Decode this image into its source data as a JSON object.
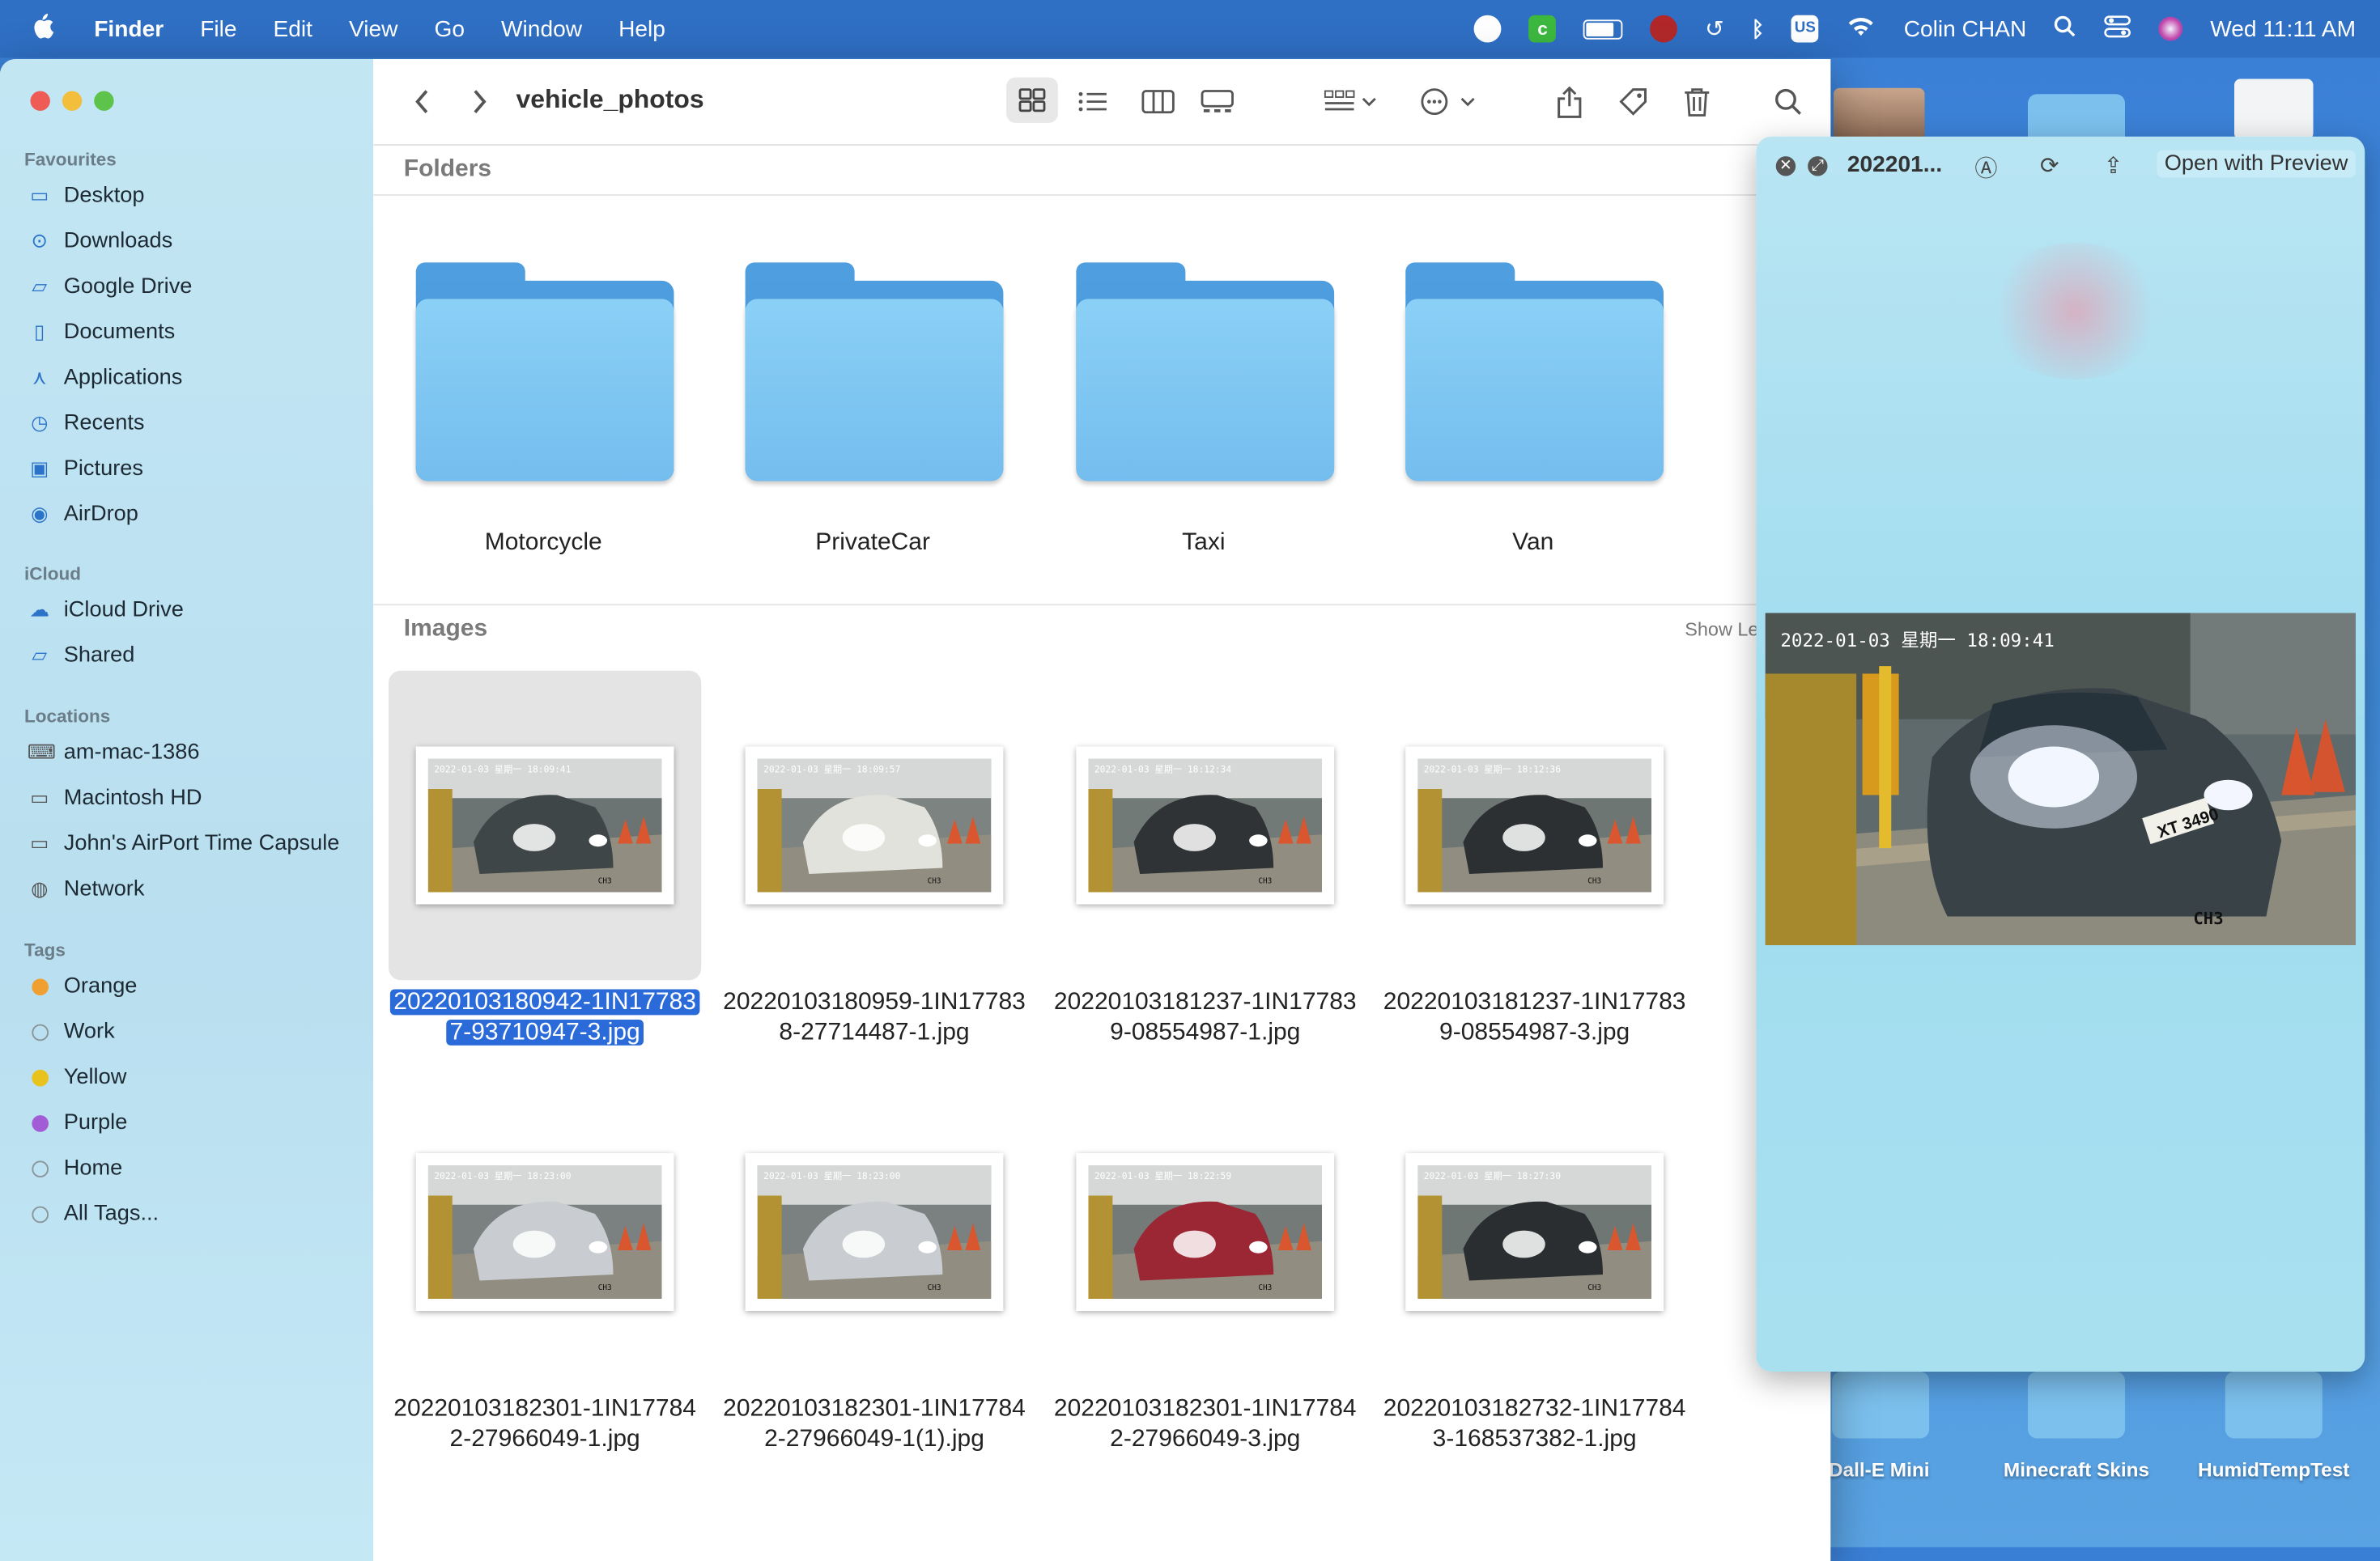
{
  "menubar": {
    "app": "Finder",
    "items": [
      "File",
      "Edit",
      "View",
      "Go",
      "Window",
      "Help"
    ],
    "user": "Colin CHAN",
    "clock": "Wed  11:11 AM",
    "input_source": "US"
  },
  "desktop": {
    "items": [
      "Dall-E Mini",
      "Minecraft Skins",
      "HumidTempTest"
    ]
  },
  "finder": {
    "title": "vehicle_photos",
    "sidebar": {
      "favourites_label": "Favourites",
      "favourites": [
        "Desktop",
        "Downloads",
        "Google Drive",
        "Documents",
        "Applications",
        "Recents",
        "Pictures",
        "AirDrop"
      ],
      "icloud_label": "iCloud",
      "icloud": [
        "iCloud Drive",
        "Shared"
      ],
      "locations_label": "Locations",
      "locations": [
        "am-mac-1386",
        "Macintosh HD",
        "John's AirPort Time Capsule",
        "Network"
      ],
      "tags_label": "Tags",
      "tags": [
        {
          "name": "Orange",
          "color": "#f0a030"
        },
        {
          "name": "Work",
          "color": ""
        },
        {
          "name": "Yellow",
          "color": "#e8c21d"
        },
        {
          "name": "Purple",
          "color": "#a25cd6"
        },
        {
          "name": "Home",
          "color": ""
        },
        {
          "name": "All Tags...",
          "color": ""
        }
      ]
    },
    "folders_label": "Folders",
    "folders": [
      "Motorcycle",
      "PrivateCar",
      "Taxi",
      "Van"
    ],
    "images_label": "Images",
    "show_less": "Show Le",
    "images": [
      {
        "line1": "20220103180942-1IN17783",
        "line2": "7-93710947-3.jpg",
        "stamp": "2022-01-03 星期一 18:09:41",
        "selected": true
      },
      {
        "line1": "20220103180959-1IN17783",
        "line2": "8-27714487-1.jpg",
        "stamp": "2022-01-03 星期一 18:09:57",
        "selected": false
      },
      {
        "line1": "20220103181237-1IN17783",
        "line2": "9-08554987-1.jpg",
        "stamp": "2022-01-03 星期一 18:12:34",
        "selected": false
      },
      {
        "line1": "20220103181237-1IN17783",
        "line2": "9-08554987-3.jpg",
        "stamp": "2022-01-03 星期一 18:12:36",
        "selected": false
      },
      {
        "line1": "20220103182301-1IN17784",
        "line2": "2-27966049-1.jpg",
        "stamp": "2022-01-03 星期一 18:23:00",
        "selected": false
      },
      {
        "line1": "20220103182301-1IN17784",
        "line2": "2-27966049-1(1).jpg",
        "stamp": "2022-01-03 星期一 18:23:00",
        "selected": false
      },
      {
        "line1": "20220103182301-1IN17784",
        "line2": "2-27966049-3.jpg",
        "stamp": "2022-01-03 星期一 18:22:59",
        "selected": false
      },
      {
        "line1": "20220103182732-1IN17784",
        "line2": "3-168537382-1.jpg",
        "stamp": "2022-01-03 星期一 18:27:30",
        "selected": false
      }
    ]
  },
  "quicklook": {
    "title": "202201...",
    "open_with": "Open with Preview",
    "image_stamp": "2022-01-03 星期一 18:09:41",
    "plate": "XT 3490",
    "channel": "CH3"
  }
}
